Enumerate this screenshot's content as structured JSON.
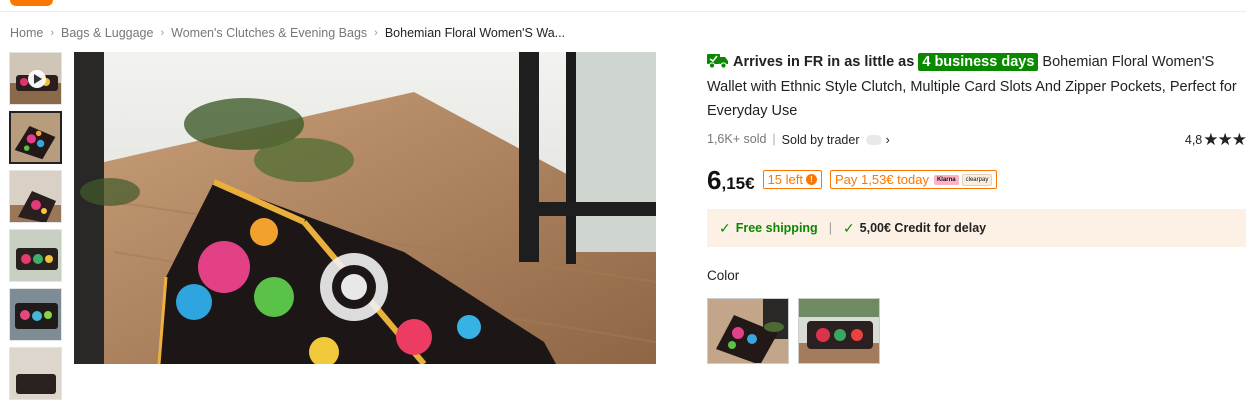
{
  "breadcrumb": {
    "items": [
      "Home",
      "Bags & Luggage",
      "Women's Clutches & Evening Bags"
    ],
    "current": "Bohemian Floral Women'S Wa..."
  },
  "product": {
    "arrival_lead": "Arrives in FR in as little as",
    "arrival_days": "4 business days",
    "title": "Bohemian Floral Women'S Wallet with Ethnic Style Clutch, Multiple Card Slots And Zipper Pockets, Perfect for Everyday Use",
    "sold": "1,6K+ sold",
    "sold_by": "Sold by trader",
    "rating": "4,8",
    "rating_stars": "★★★",
    "price_int": "6",
    "price_dec": ",15€",
    "stock_badge": "15 left",
    "installment": "Pay 1,53€ today",
    "klarna_label": "Klarna",
    "clearpay_label": "clearpay"
  },
  "shipping": {
    "free": "Free shipping",
    "credit": "5,00€ Credit for delay"
  },
  "color": {
    "label": "Color"
  },
  "colors": {
    "accent": "#fb7701",
    "success": "#0a8800",
    "shipping_bg": "#fdf1e6"
  },
  "icons": {
    "truck": "truck-icon",
    "play": "play-icon",
    "check": "check-icon",
    "chevron": "chevron-right-icon",
    "info": "info-icon"
  }
}
